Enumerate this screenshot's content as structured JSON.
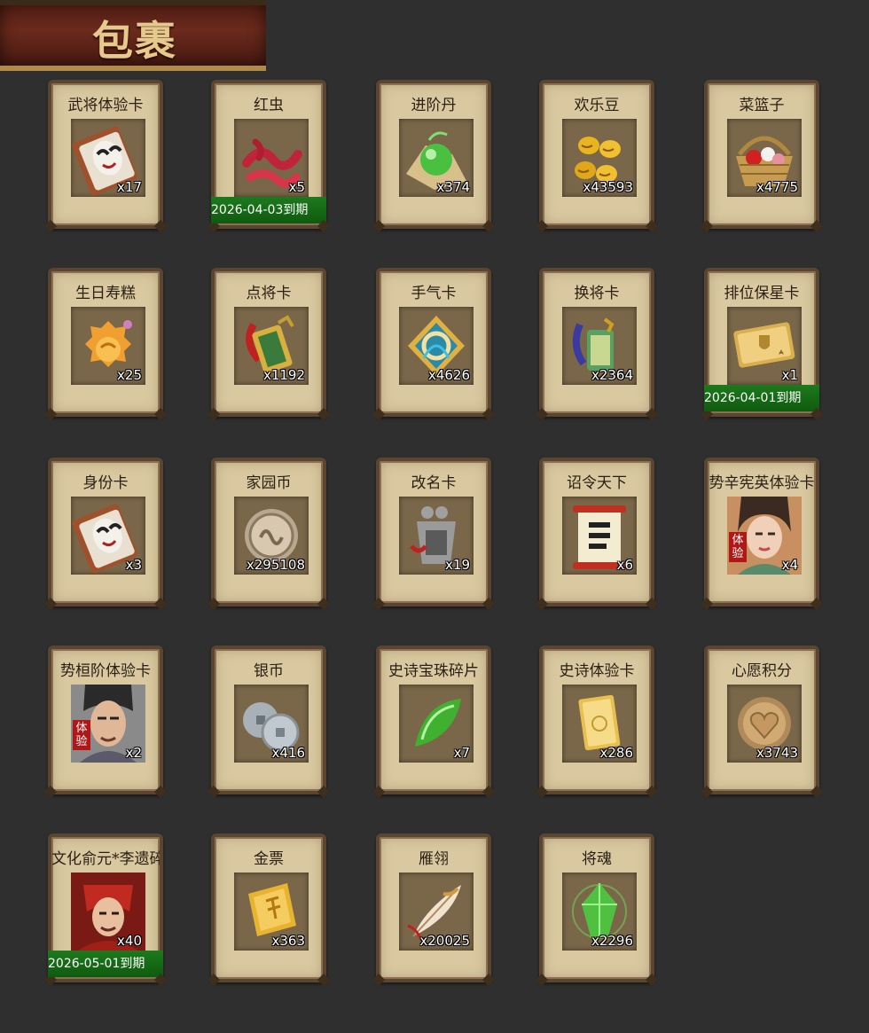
{
  "header": {
    "title": "包裹"
  },
  "colors": {
    "card_bg": "#d9c8a0",
    "frame": "#5a4630",
    "expiry_bg": "#137013",
    "trial_tag": "#b01818"
  },
  "items": [
    {
      "name": "武将体验卡",
      "qty": "x17",
      "icon": "opera-mask-card-icon"
    },
    {
      "name": "红虫",
      "qty": "x5",
      "icon": "red-worm-icon",
      "expiry": "2026-04-03到期"
    },
    {
      "name": "进阶丹",
      "qty": "x374",
      "icon": "green-pill-icon"
    },
    {
      "name": "欢乐豆",
      "qty": "x43593",
      "icon": "gold-beans-icon"
    },
    {
      "name": "菜篮子",
      "qty": "x4775",
      "icon": "flower-basket-icon"
    },
    {
      "name": "生日寿糕",
      "qty": "x25",
      "icon": "birthday-cake-icon"
    },
    {
      "name": "点将卡",
      "qty": "x1192",
      "icon": "general-token-icon"
    },
    {
      "name": "手气卡",
      "qty": "x4626",
      "icon": "luck-card-icon"
    },
    {
      "name": "换将卡",
      "qty": "x2364",
      "icon": "swap-token-icon"
    },
    {
      "name": "排位保星卡",
      "qty": "x1",
      "icon": "shield-card-icon",
      "expiry": "2026-04-01到期"
    },
    {
      "name": "身份卡",
      "qty": "x3",
      "icon": "opera-mask-card-icon"
    },
    {
      "name": "家园币",
      "qty": "x295108",
      "icon": "home-coin-icon"
    },
    {
      "name": "改名卡",
      "qty": "x19",
      "icon": "rename-tag-icon"
    },
    {
      "name": "诏令天下",
      "qty": "x6",
      "icon": "edict-scroll-icon"
    },
    {
      "name": "势辛宪英体验卡",
      "qty": "x4",
      "icon": "female-portrait-icon",
      "trial": "体验"
    },
    {
      "name": "势桓阶体验卡",
      "qty": "x2",
      "icon": "male-portrait-icon",
      "trial": "体验"
    },
    {
      "name": "银币",
      "qty": "x416",
      "icon": "silver-coins-icon"
    },
    {
      "name": "史诗宝珠碎片",
      "qty": "x7",
      "icon": "green-shard-icon"
    },
    {
      "name": "史诗体验卡",
      "qty": "x286",
      "icon": "gold-card-icon"
    },
    {
      "name": "心愿积分",
      "qty": "x3743",
      "icon": "heart-coin-icon"
    },
    {
      "name": "文化俞元*李遗碎片",
      "qty": "x40",
      "icon": "warrior-portrait-icon",
      "expiry": "2026-05-01到期"
    },
    {
      "name": "金票",
      "qty": "x363",
      "icon": "gold-ticket-icon"
    },
    {
      "name": "雁翎",
      "qty": "x20025",
      "icon": "feather-icon"
    },
    {
      "name": "将魂",
      "qty": "x2296",
      "icon": "green-crystal-icon"
    }
  ]
}
